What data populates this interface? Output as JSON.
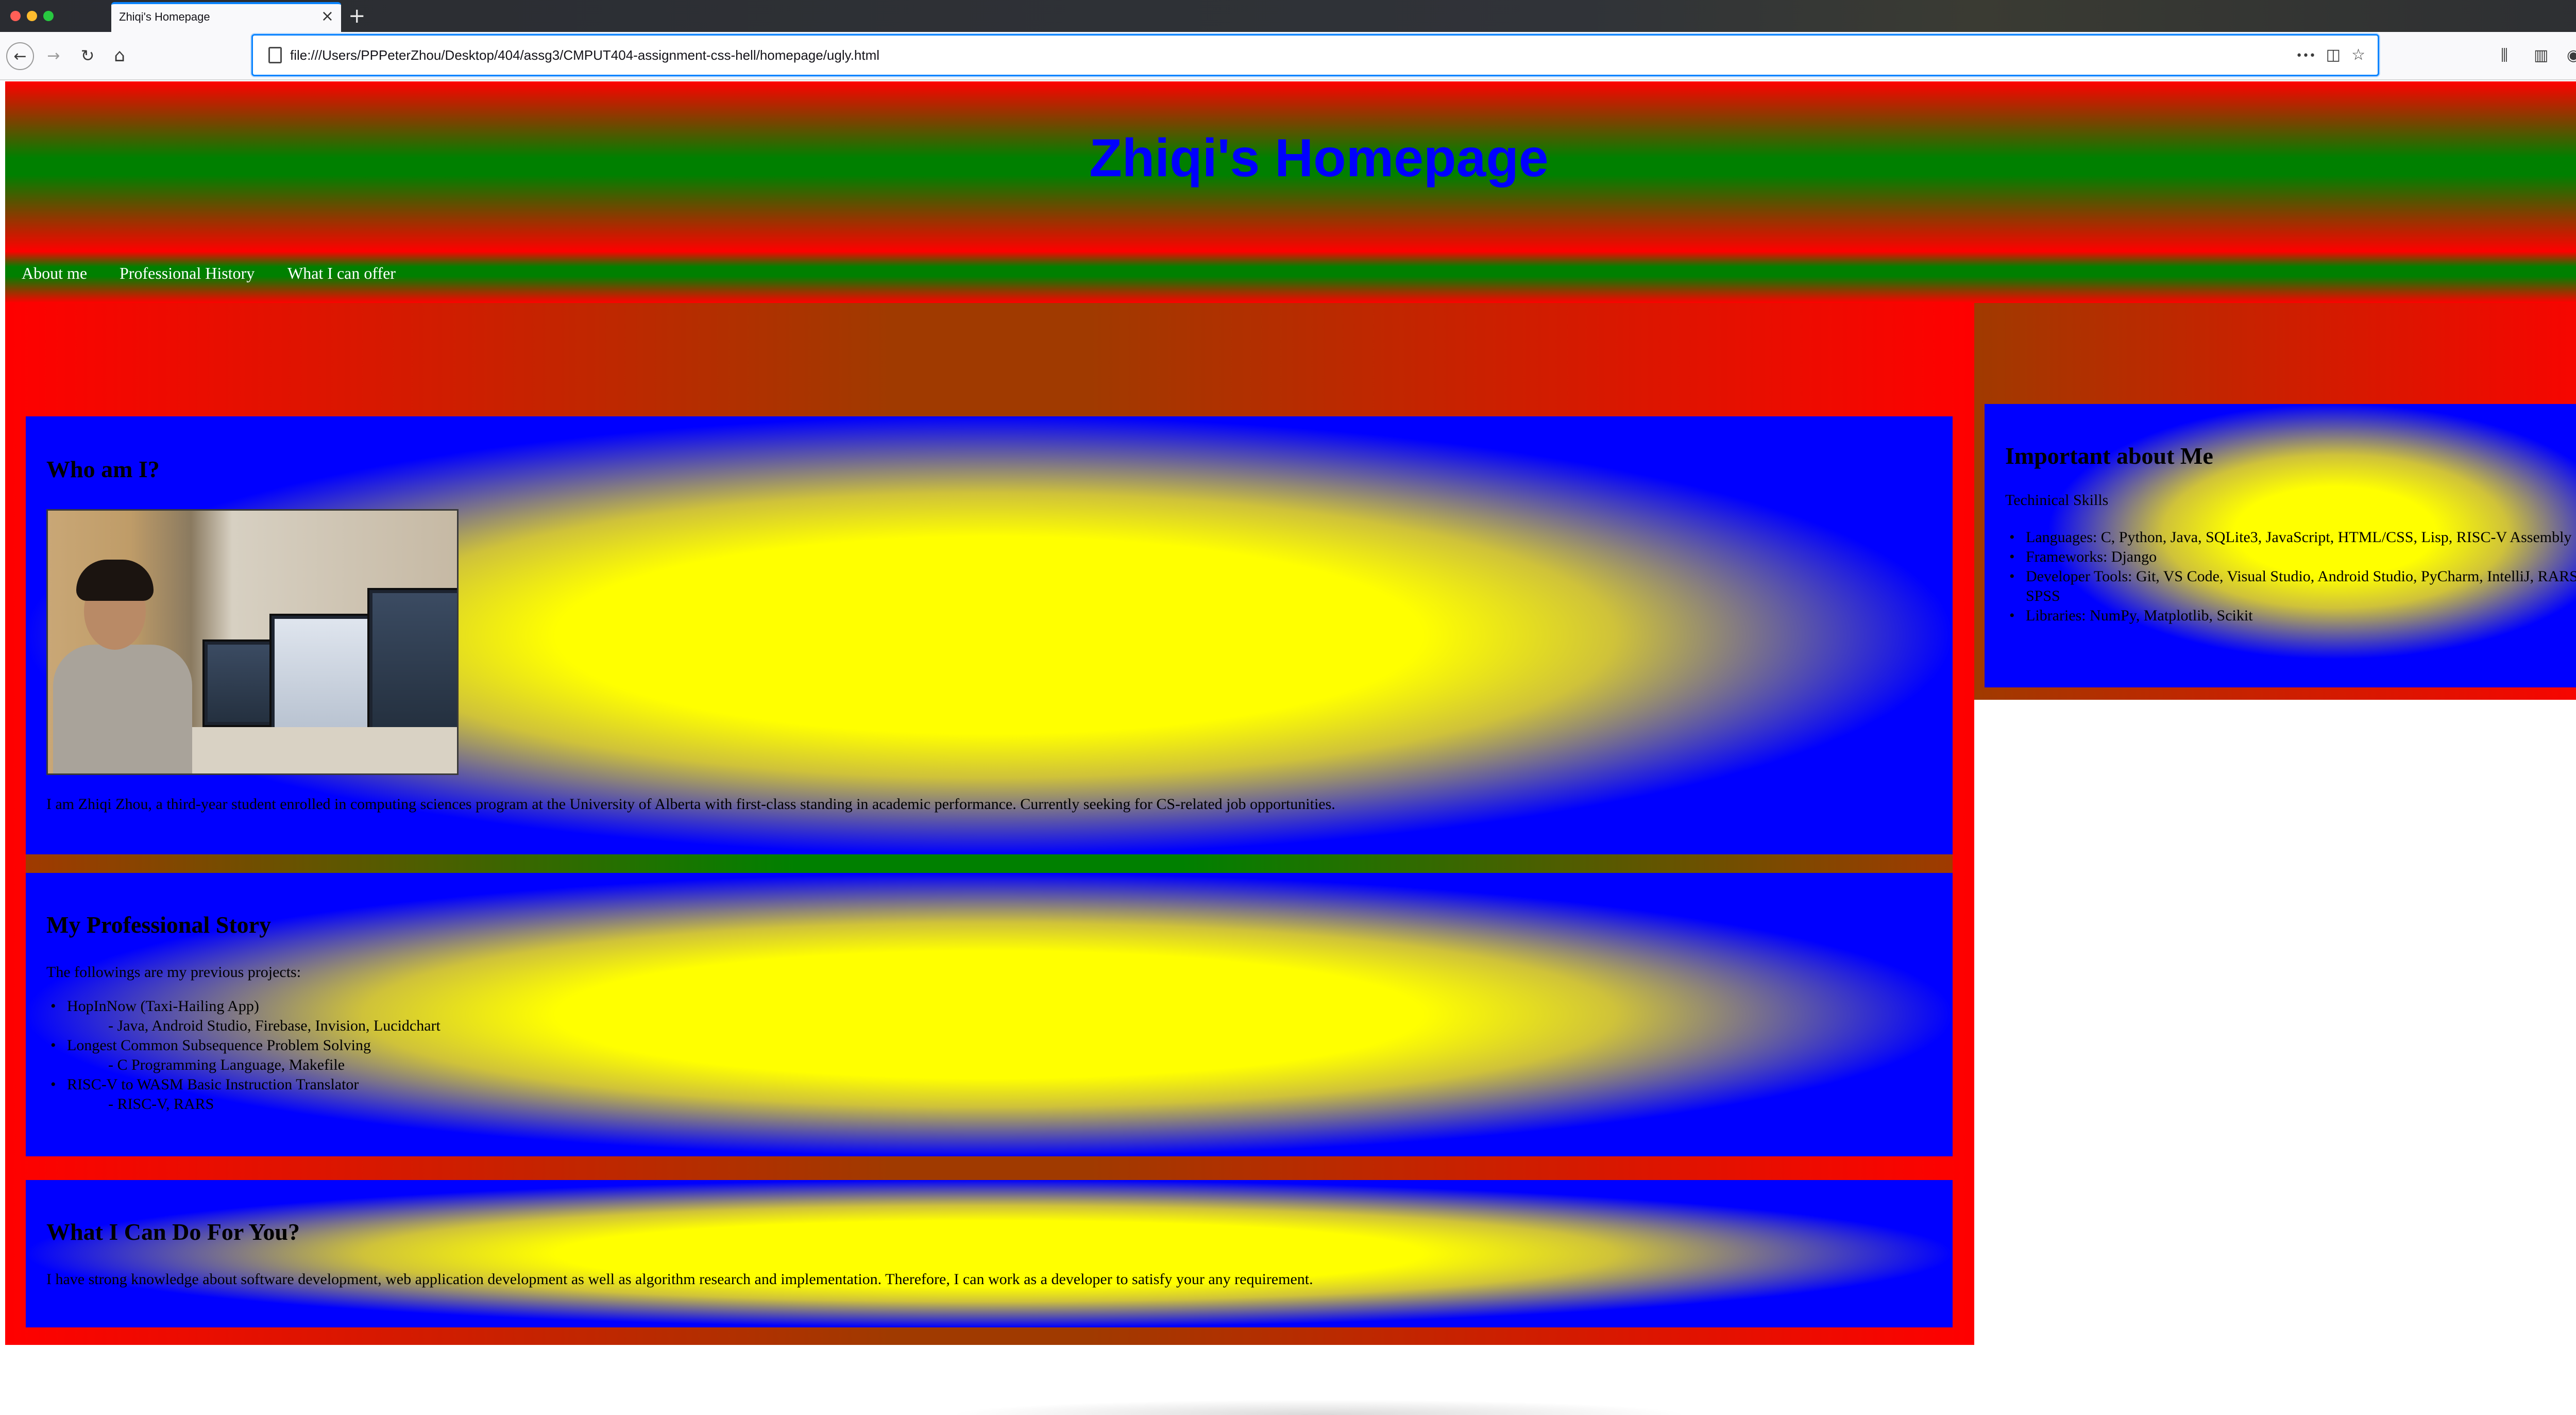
{
  "browser": {
    "tab_title": "Zhiqi's Homepage",
    "tab_close": "×",
    "new_tab": "+",
    "url": "file:///Users/PPPeterZhou/Desktop/404/assg3/CMPUT404-assignment-css-hell/homepage/ugly.html",
    "icons": {
      "back": "←",
      "forward": "→",
      "reload": "↻",
      "home": "⌂",
      "page_actions": "•••",
      "pocket": "◫",
      "bookmark": "☆",
      "library": "⫼",
      "sidebar": "▥",
      "account": "◉",
      "menu": "☰"
    },
    "colors": {
      "accent": "#0a84ff",
      "chrome": "#f9f9fb"
    }
  },
  "header": {
    "title": "Zhiqi's Homepage"
  },
  "nav": {
    "items": [
      "About me",
      "Professional History",
      "What I can offer"
    ]
  },
  "about": {
    "heading": "Who am I?",
    "bio": "I am Zhiqi Zhou, a third-year student enrolled in computing sciences program at the University of Alberta with first-class standing in academic performance. Currently seeking for CS-related job opportunities."
  },
  "story": {
    "heading": "My Professional Story",
    "intro": "The followings are my previous projects:",
    "projects": [
      {
        "name": "HopInNow (Taxi-Hailing App)",
        "tech": "- Java, Android Studio, Firebase, Invision, Lucidchart"
      },
      {
        "name": "Longest Common Subsequence Problem Solving",
        "tech": "- C Programming Language, Makefile"
      },
      {
        "name": "RISC-V to WASM Basic Instruction Translator",
        "tech": "- RISC-V, RARS"
      }
    ]
  },
  "offer": {
    "heading": "What I Can Do For You?",
    "text": "I have strong knowledge about software development, web application development as well as algorithm research and implementation. Therefore, I can work as a developer to satisfy your any requirement."
  },
  "sidebar": {
    "heading": "Important about Me",
    "subheading": "Techinical Skills",
    "skills": [
      "Languages: C, Python, Java, SQLite3, JavaScript, HTML/CSS, Lisp, RISC-V Assembly",
      "Frameworks: Django",
      "Developer Tools: Git, VS Code, Visual Studio, Android Studio, PyCharm, IntelliJ, RARS, SPSS",
      "Libraries: NumPy, Matplotlib, Scikit"
    ]
  },
  "page_colors": {
    "red": "#ff0000",
    "green": "#008000",
    "blue": "#0000ff",
    "yellow": "#ffff00"
  }
}
